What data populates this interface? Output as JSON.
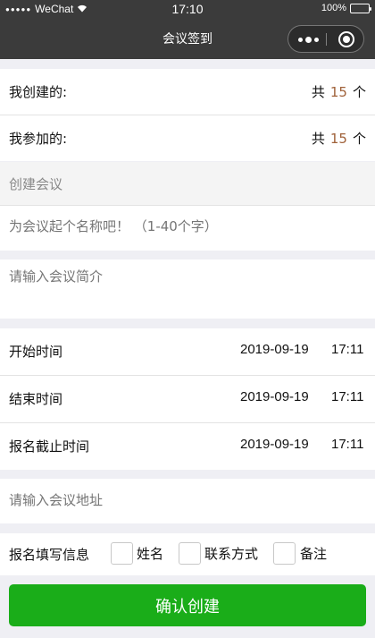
{
  "status_bar": {
    "carrier": "WeChat",
    "time": "17:10",
    "battery": "100%"
  },
  "nav": {
    "title": "会议签到"
  },
  "summary": {
    "created_label": "我创建的:",
    "joined_label": "我参加的:",
    "count_prefix": "共",
    "count_suffix": "个",
    "created_count": "15",
    "joined_count": "15"
  },
  "form": {
    "section_title": "创建会议",
    "name_placeholder": "为会议起个名称吧！ （1-40个字）",
    "intro_placeholder": "请输入会议简介",
    "start_label": "开始时间",
    "end_label": "结束时间",
    "deadline_label": "报名截止时间",
    "start_date": "2019-09-19",
    "start_time": "17:11",
    "end_date": "2019-09-19",
    "end_time": "17:11",
    "deadline_date": "2019-09-19",
    "deadline_time": "17:11",
    "address_placeholder": "请输入会议地址",
    "info_label": "报名填写信息",
    "option_name": "姓名",
    "option_contact": "联系方式",
    "option_remark": "备注",
    "submit_label": "确认创建"
  },
  "colors": {
    "accent": "#1aad19",
    "count_number": "#a0623a",
    "nav_background": "#3b3b3b"
  }
}
